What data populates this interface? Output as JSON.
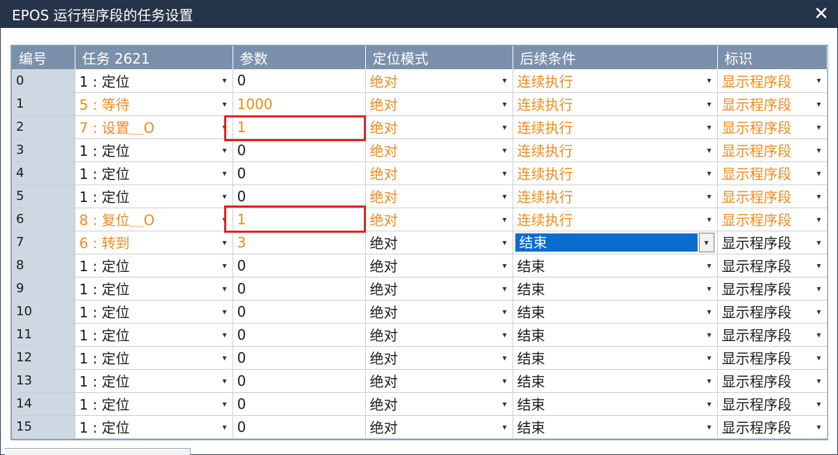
{
  "window": {
    "title": "EPOS 运行程序段的任务设置",
    "close_label": "✕"
  },
  "table": {
    "headers": [
      "编号",
      "任务 2621",
      "参数",
      "定位模式",
      "后续条件",
      "标识"
    ],
    "rows": [
      {
        "num": "0",
        "task": "1 : 定位",
        "param": "0",
        "mode": "绝对",
        "cond": "连续执行",
        "flag": "显示程序段",
        "orange_task": false,
        "orange_param": false,
        "orange_rest": true
      },
      {
        "num": "1",
        "task": "5 : 等待",
        "param": "1000",
        "mode": "绝对",
        "cond": "连续执行",
        "flag": "显示程序段",
        "orange_task": true,
        "orange_param": true,
        "orange_rest": true
      },
      {
        "num": "2",
        "task": "7 : 设置＿O",
        "param": "1",
        "mode": "绝对",
        "cond": "连续执行",
        "flag": "显示程序段",
        "orange_task": true,
        "orange_param": true,
        "orange_rest": true
      },
      {
        "num": "3",
        "task": "1 : 定位",
        "param": "0",
        "mode": "绝对",
        "cond": "连续执行",
        "flag": "显示程序段",
        "orange_task": false,
        "orange_param": false,
        "orange_rest": true
      },
      {
        "num": "4",
        "task": "1 : 定位",
        "param": "0",
        "mode": "绝对",
        "cond": "连续执行",
        "flag": "显示程序段",
        "orange_task": false,
        "orange_param": false,
        "orange_rest": true
      },
      {
        "num": "5",
        "task": "1 : 定位",
        "param": "0",
        "mode": "绝对",
        "cond": "连续执行",
        "flag": "显示程序段",
        "orange_task": false,
        "orange_param": false,
        "orange_rest": true
      },
      {
        "num": "6",
        "task": "8 : 复位＿O",
        "param": "1",
        "mode": "绝对",
        "cond": "连续执行",
        "flag": "显示程序段",
        "orange_task": true,
        "orange_param": true,
        "orange_rest": true
      },
      {
        "num": "7",
        "task": "6 : 转到",
        "param": "3",
        "mode": "绝对",
        "cond": "结束",
        "flag": "显示程序段",
        "orange_task": true,
        "orange_param": true,
        "orange_rest": false,
        "selected": true
      },
      {
        "num": "8",
        "task": "1 : 定位",
        "param": "0",
        "mode": "绝对",
        "cond": "结束",
        "flag": "显示程序段",
        "orange_task": false,
        "orange_param": false,
        "orange_rest": false
      },
      {
        "num": "9",
        "task": "1 : 定位",
        "param": "0",
        "mode": "绝对",
        "cond": "结束",
        "flag": "显示程序段",
        "orange_task": false,
        "orange_param": false,
        "orange_rest": false
      },
      {
        "num": "10",
        "task": "1 : 定位",
        "param": "0",
        "mode": "绝对",
        "cond": "结束",
        "flag": "显示程序段",
        "orange_task": false,
        "orange_param": false,
        "orange_rest": false
      },
      {
        "num": "11",
        "task": "1 : 定位",
        "param": "0",
        "mode": "绝对",
        "cond": "结束",
        "flag": "显示程序段",
        "orange_task": false,
        "orange_param": false,
        "orange_rest": false
      },
      {
        "num": "12",
        "task": "1 : 定位",
        "param": "0",
        "mode": "绝对",
        "cond": "结束",
        "flag": "显示程序段",
        "orange_task": false,
        "orange_param": false,
        "orange_rest": false
      },
      {
        "num": "13",
        "task": "1 : 定位",
        "param": "0",
        "mode": "绝对",
        "cond": "结束",
        "flag": "显示程序段",
        "orange_task": false,
        "orange_param": false,
        "orange_rest": false
      },
      {
        "num": "14",
        "task": "1 : 定位",
        "param": "0",
        "mode": "绝对",
        "cond": "结束",
        "flag": "显示程序段",
        "orange_task": false,
        "orange_param": false,
        "orange_rest": false
      },
      {
        "num": "15",
        "task": "1 : 定位",
        "param": "0",
        "mode": "绝对",
        "cond": "结束",
        "flag": "显示程序段",
        "orange_task": false,
        "orange_param": false,
        "orange_rest": false
      }
    ],
    "dropdown_glyph": "▾"
  },
  "colors": {
    "orange": "#f08a1c",
    "header": "#7b90ab",
    "titlebar": "#253449",
    "highlight": "#e02020",
    "selection": "#0a6ccf"
  }
}
